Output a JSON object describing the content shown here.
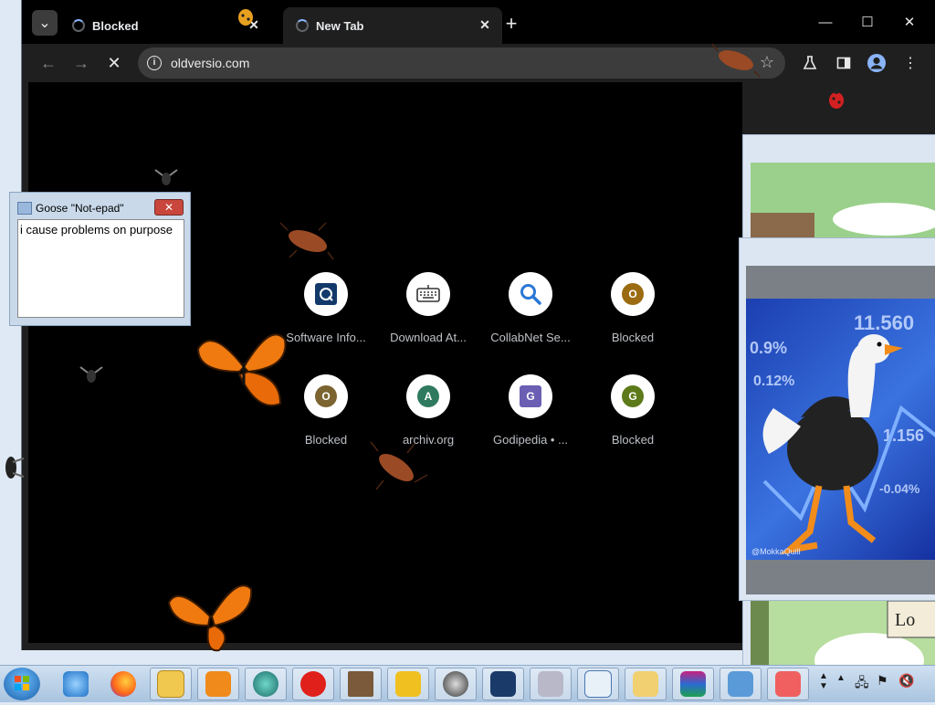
{
  "browser": {
    "tabs": [
      {
        "title": "Blocked",
        "active": false,
        "loading": true
      },
      {
        "title": "New Tab",
        "active": true,
        "loading": true
      }
    ],
    "new_tab_icon": "plus-icon",
    "window_controls": {
      "minimize": "—",
      "maximize": "☐",
      "close": "✕"
    },
    "address_bar": {
      "url": "oldversio.com",
      "star_icon": "star-icon"
    },
    "toolbar_icons": [
      "labs-icon",
      "side-panel-icon",
      "profile-icon",
      "menu-icon"
    ]
  },
  "shortcuts": [
    {
      "label": "Software Info...",
      "icon": "target-icon",
      "color": "#13396a"
    },
    {
      "label": "Download At...",
      "icon": "keyboard-icon",
      "color": "#333333"
    },
    {
      "label": "CollabNet Se...",
      "icon": "magnifier-icon",
      "color": "#2a78d6"
    },
    {
      "label": "Blocked",
      "letter": "O",
      "color": "#9a6b10"
    },
    {
      "label": "Blocked",
      "letter": "O",
      "color": "#7b6430"
    },
    {
      "label": "archiv.org",
      "letter": "A",
      "color": "#2f7a5f"
    },
    {
      "label": "Godipedia • ...",
      "letter": "G",
      "color": "#6a5fb3"
    },
    {
      "label": "Blocked",
      "letter": "G",
      "color": "#5d7a1a"
    }
  ],
  "notepad": {
    "title": "Goose \"Not-epad\"",
    "text": "i cause problems on purpose",
    "close": "✕"
  },
  "meme_panel": {
    "tickers": [
      "11.560",
      "0.9%",
      "0.12%",
      "1.156",
      "-0.04%"
    ],
    "credit": "@MokkaQuill"
  },
  "side_panel_text": "Lo",
  "taskbar": {
    "apps": [
      "internet-explorer-icon",
      "firefox-icon",
      "folder-icon",
      "media-player-icon",
      "globe-app-icon",
      "opera-icon",
      "minecraft-icon",
      "tools-icon",
      "gauge-icon",
      "ship-icon",
      "chain-icon",
      "window-app-icon",
      "installer-icon",
      "winrar-icon",
      "user-app-icon",
      "eraser-icon"
    ]
  }
}
